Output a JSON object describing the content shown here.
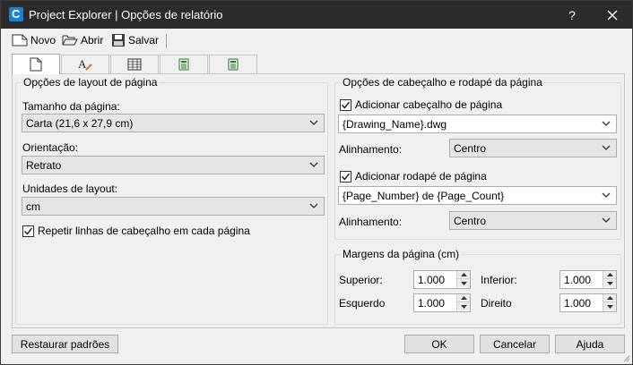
{
  "window": {
    "title": "Project Explorer | Opções de relatório",
    "help": "?",
    "close": "✕"
  },
  "toolbar": {
    "new_label": "Novo",
    "open_label": "Abrir",
    "save_label": "Salvar"
  },
  "tabs": [
    {
      "icon": "page-icon",
      "active": true
    },
    {
      "icon": "font-style-icon"
    },
    {
      "icon": "table-icon"
    },
    {
      "icon": "calculator-icon"
    },
    {
      "icon": "calculator-icon"
    }
  ],
  "page_layout": {
    "group_title": "Opções de layout de página",
    "size_label": "Tamanho da página:",
    "size_value": "Carta (21,6 x 27,9 cm)",
    "orientation_label": "Orientação:",
    "orientation_value": "Retrato",
    "units_label": "Unidades de layout:",
    "units_value": "cm",
    "repeat_label": "Repetir linhas de cabeçalho em cada página",
    "repeat_checked": true
  },
  "header_footer": {
    "group_title": "Opções de cabeçalho e rodapé da página",
    "add_header_label": "Adicionar cabeçalho de página",
    "add_header_checked": true,
    "header_value": "{Drawing_Name}.dwg",
    "header_align_label": "Alinhamento:",
    "header_align_value": "Centro",
    "add_footer_label": "Adicionar rodapé de página",
    "add_footer_checked": true,
    "footer_value": "{Page_Number} de {Page_Count}",
    "footer_align_label": "Alinhamento:",
    "footer_align_value": "Centro"
  },
  "margins": {
    "group_title": "Margens da página (cm)",
    "top_label": "Superior:",
    "top_value": "1.000",
    "bottom_label": "Inferior:",
    "bottom_value": "1.000",
    "left_label": "Esquerdo",
    "left_value": "1.000",
    "right_label": "Direito",
    "right_value": "1.000"
  },
  "footer_buttons": {
    "restore": "Restaurar padrões",
    "ok": "OK",
    "cancel": "Cancelar",
    "help": "Ajuda"
  }
}
